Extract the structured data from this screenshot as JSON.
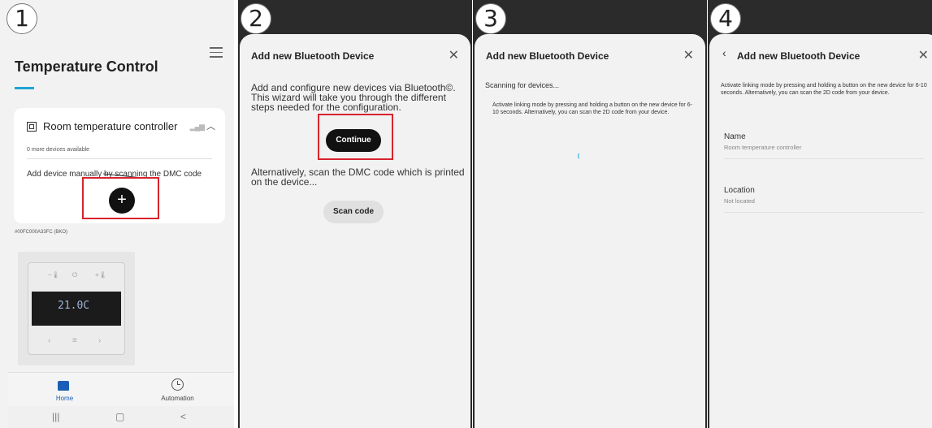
{
  "steps": [
    "1",
    "2",
    "3",
    "4"
  ],
  "panel1": {
    "title": "Temperature Control",
    "card": {
      "device_name": "Room temperature controller",
      "devices_available": "0 more devices available",
      "manual_text": "Add device manually by scanning the DMC code",
      "add_label": "+"
    },
    "hardware_id": "#00FC000A33FC (BKO)",
    "thermostat_display": "21.0C",
    "tabs": [
      {
        "label": "Home",
        "icon": "home-icon",
        "active": true
      },
      {
        "label": "Automation",
        "icon": "clock-icon",
        "active": false
      }
    ],
    "system_nav": [
      "|||",
      "▢",
      "<"
    ]
  },
  "panel2": {
    "title": "Add new Bluetooth Device",
    "intro": "Add and configure new devices via Bluetooth©. This wizard will take you through the different steps needed for the configuration.",
    "continue_label": "Continue",
    "alt_text": "Alternatively, scan the DMC code which is printed on the device...",
    "scan_label": "Scan code"
  },
  "panel3": {
    "title": "Add new Bluetooth Device",
    "status": "Scanning for devices...",
    "instructions": "Activate linking mode by pressing and holding a button on the new device for 6-10 seconds. Alternatively, you can scan the 2D code from your device."
  },
  "panel4": {
    "title": "Add new Bluetooth Device",
    "instructions": "Activate linking mode by pressing and holding a button on the new device for 6-10 seconds. Alternatively, you can scan the 2D code from your device.",
    "fields": [
      {
        "label": "Name",
        "value": "Room temperature controller"
      },
      {
        "label": "Location",
        "value": "Not located"
      }
    ]
  },
  "colors": {
    "accent": "#1fa3d8",
    "highlight": "#d9232e",
    "home_icon": "#1a5fb5",
    "header_dark": "#2b2b2b"
  }
}
